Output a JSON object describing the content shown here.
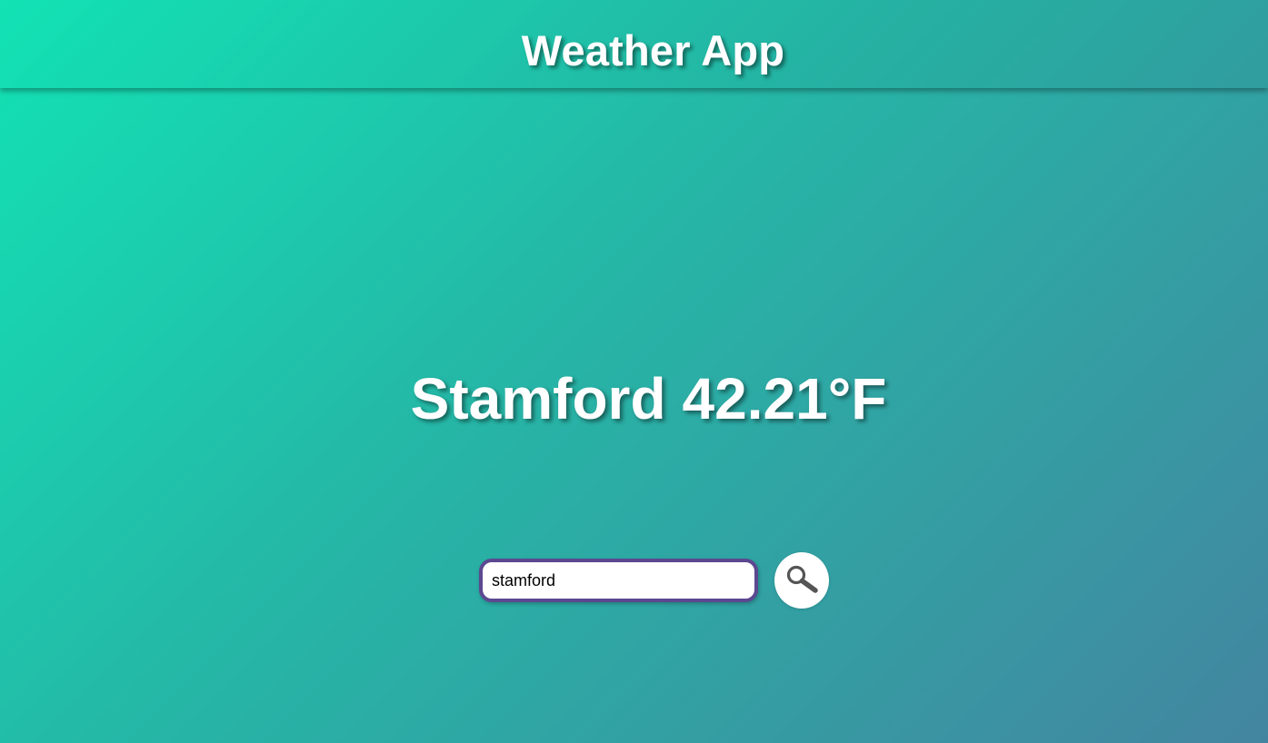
{
  "header": {
    "title": "Weather App"
  },
  "weather": {
    "city": "Stamford",
    "temperature": "42.21°F"
  },
  "search": {
    "value": "stamford",
    "button_icon": "search-icon"
  },
  "colors": {
    "gradient_start": "#12e2b4",
    "gradient_end": "#4385a0",
    "input_border": "#5c4890",
    "icon": "#555555"
  }
}
